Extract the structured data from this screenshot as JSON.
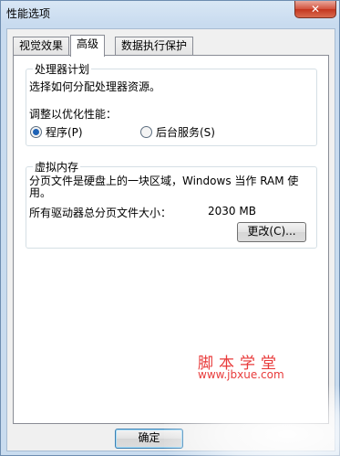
{
  "window": {
    "title": "性能选项"
  },
  "tabs": [
    {
      "label": "视觉效果"
    },
    {
      "label": "高级"
    },
    {
      "label": "数据执行保护"
    }
  ],
  "processor": {
    "group_title": "处理器计划",
    "description": "选择如何分配处理器资源。",
    "adjust_label": "调整以优化性能：",
    "option_programs": "程序(P)",
    "option_background": "后台服务(S)",
    "selected": "programs"
  },
  "virtual_memory": {
    "group_title": "虚拟内存",
    "description": "分页文件是硬盘上的一块区域，Windows 当作 RAM 使用。",
    "total_label": "所有驱动器总分页文件大小：",
    "total_value": "2030 MB",
    "change_button": "更改(C)..."
  },
  "footer": {
    "ok_button": "确定"
  },
  "watermark": {
    "name": "脚本学堂",
    "url": "www.jbxue.com"
  }
}
